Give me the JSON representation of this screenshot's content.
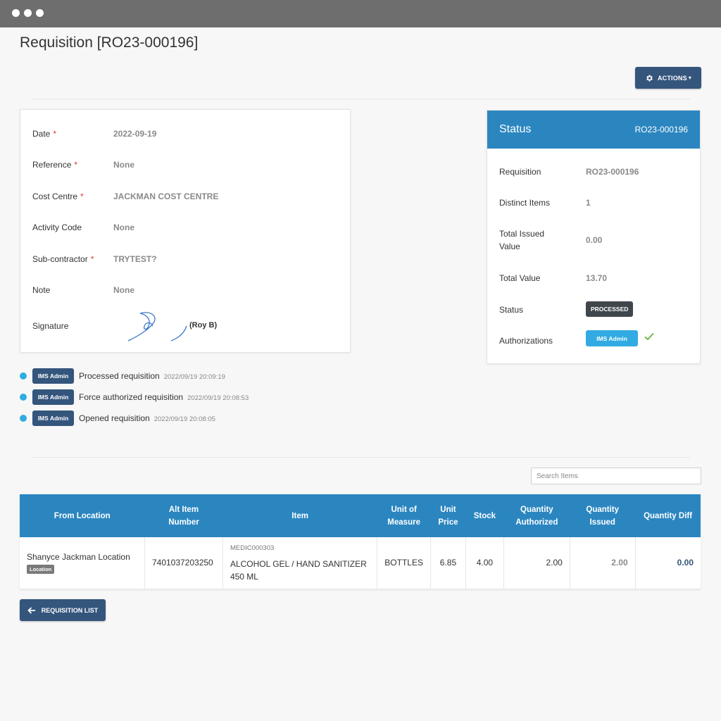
{
  "page": {
    "title": "Requisition [RO23-000196]",
    "actions_label": "ACTIONS"
  },
  "details": [
    {
      "label": "Date",
      "required": "*",
      "value": "2022-09-19"
    },
    {
      "label": "Reference",
      "required": "*",
      "value": "None"
    },
    {
      "label": "Cost Centre",
      "required": "*",
      "value": "JACKMAN COST CENTRE"
    },
    {
      "label": "Activity Code",
      "required": "",
      "value": "None"
    },
    {
      "label": "Sub-contractor",
      "required": "*",
      "value": "TRYTEST?"
    },
    {
      "label": "Note",
      "required": "",
      "value": "None"
    }
  ],
  "signature": {
    "label": "Signature",
    "name": "(Roy B)"
  },
  "status_card": {
    "title": "Status",
    "code": "RO23-000196",
    "rows": [
      {
        "label": "Requisition",
        "value": "RO23-000196"
      },
      {
        "label": "Distinct Items",
        "value": "1"
      },
      {
        "label": "Total Issued Value",
        "value": "0.00"
      },
      {
        "label": "Total Value",
        "value": "13.70"
      },
      {
        "label": "Status",
        "value": ""
      },
      {
        "label": "Authorizations",
        "value": ""
      }
    ],
    "status_badge": "PROCESSED",
    "auth_badge": "IMS Admin"
  },
  "timeline": [
    {
      "user": "IMS Admin",
      "action": "Processed requisition",
      "time": "2022/09/19 20:09:19"
    },
    {
      "user": "IMS Admin",
      "action": "Force authorized requisition",
      "time": "2022/09/19 20:08:53"
    },
    {
      "user": "IMS Admin",
      "action": "Opened requisition",
      "time": "2022/09/19 20:08:05"
    }
  ],
  "search": {
    "placeholder": "Search Items"
  },
  "table": {
    "headers": {
      "from_location": "From Location",
      "alt_item_l1": "Alt Item",
      "alt_item_l2": "Number",
      "item": "Item",
      "uom_l1": "Unit of",
      "uom_l2": "Measure",
      "price_l1": "Unit",
      "price_l2": "Price",
      "stock": "Stock",
      "qauth_l1": "Quantity",
      "qauth_l2": "Authorized",
      "qiss_l1": "Quantity",
      "qiss_l2": "Issued",
      "qdiff": "Quantity Diff"
    },
    "row": {
      "location": "Shanyce Jackman Location",
      "location_badge": "Location",
      "alt_number": "7401037203250",
      "item_code": "MEDIC000303",
      "item_name": "ALCOHOL GEL / HAND SANITIZER 450 ML",
      "uom": "BOTTLES",
      "unit_price": "6.85",
      "stock": "4.00",
      "qty_authorized": "2.00",
      "qty_issued": "2.00",
      "qty_diff": "0.00"
    }
  },
  "back_button": "REQUISITION LIST",
  "colors": {
    "primary_blue": "#2b86c0",
    "navy": "#34557c",
    "light_blue": "#31abe2",
    "required": "#e03535",
    "check": "#6dbb4a"
  }
}
